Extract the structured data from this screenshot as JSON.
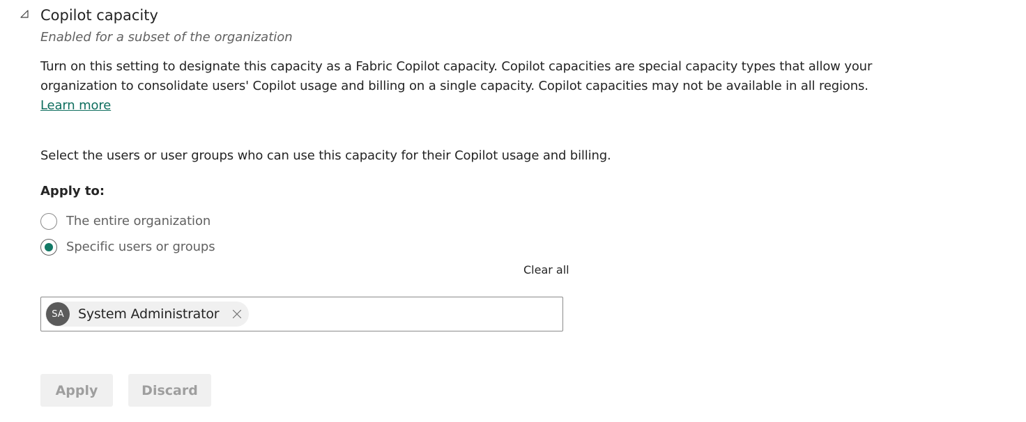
{
  "section": {
    "title": "Copilot capacity",
    "subtitle": "Enabled for a subset of the organization",
    "description": "Turn on this setting to designate this capacity as a Fabric Copilot capacity. Copilot capacities are special capacity types that allow your organization to consolidate users' Copilot usage and billing on a single capacity. Copilot capacities may not be available in all regions.",
    "learn_more": "Learn more",
    "collapse_icon": "collapse-triangle-icon"
  },
  "select_text": "Select the users or user groups who can use this capacity for their Copilot usage and billing.",
  "apply_to": {
    "label": "Apply to:",
    "options": [
      {
        "label": "The entire organization",
        "checked": false
      },
      {
        "label": "Specific users or groups",
        "checked": true
      }
    ]
  },
  "picker": {
    "clear_all": "Clear all",
    "chips": [
      {
        "initials": "SA",
        "name": "System Administrator",
        "remove_icon": "close-icon"
      }
    ]
  },
  "buttons": {
    "apply": "Apply",
    "discard": "Discard"
  },
  "colors": {
    "accent": "#117865",
    "link": "#0e6e5e",
    "disabled_text": "#9e9e9e",
    "button_bg": "#f0f0f0"
  }
}
